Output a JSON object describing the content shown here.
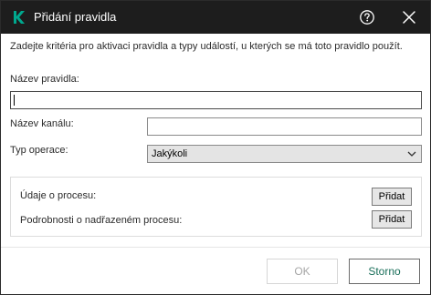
{
  "window": {
    "title": "Přidání pravidla",
    "icons": {
      "logo": "kaspersky-k-logo",
      "help": "help-circle-icon",
      "close": "close-icon"
    },
    "colors": {
      "titlebar": "#1d1d1d",
      "logo_green": "#00a88e",
      "accent_text": "#1a6f5a"
    }
  },
  "description": "Zadejte kritéria pro aktivaci pravidla a typy událostí, u kterých se má toto pravidlo použít.",
  "form": {
    "rule_name_label": "Název pravidla:",
    "rule_name_value": "",
    "channel_name_label": "Název kanálu:",
    "channel_name_value": "",
    "operation_type_label": "Typ operace:",
    "operation_type_value": "Jakýkoli"
  },
  "process_panel": {
    "process_data_label": "Údaje o procesu:",
    "process_data_button": "Přidat",
    "parent_process_label": "Podrobnosti o nadřazeném procesu:",
    "parent_process_button": "Přidat"
  },
  "footer": {
    "ok_label": "OK",
    "ok_enabled": false,
    "cancel_label": "Storno"
  }
}
